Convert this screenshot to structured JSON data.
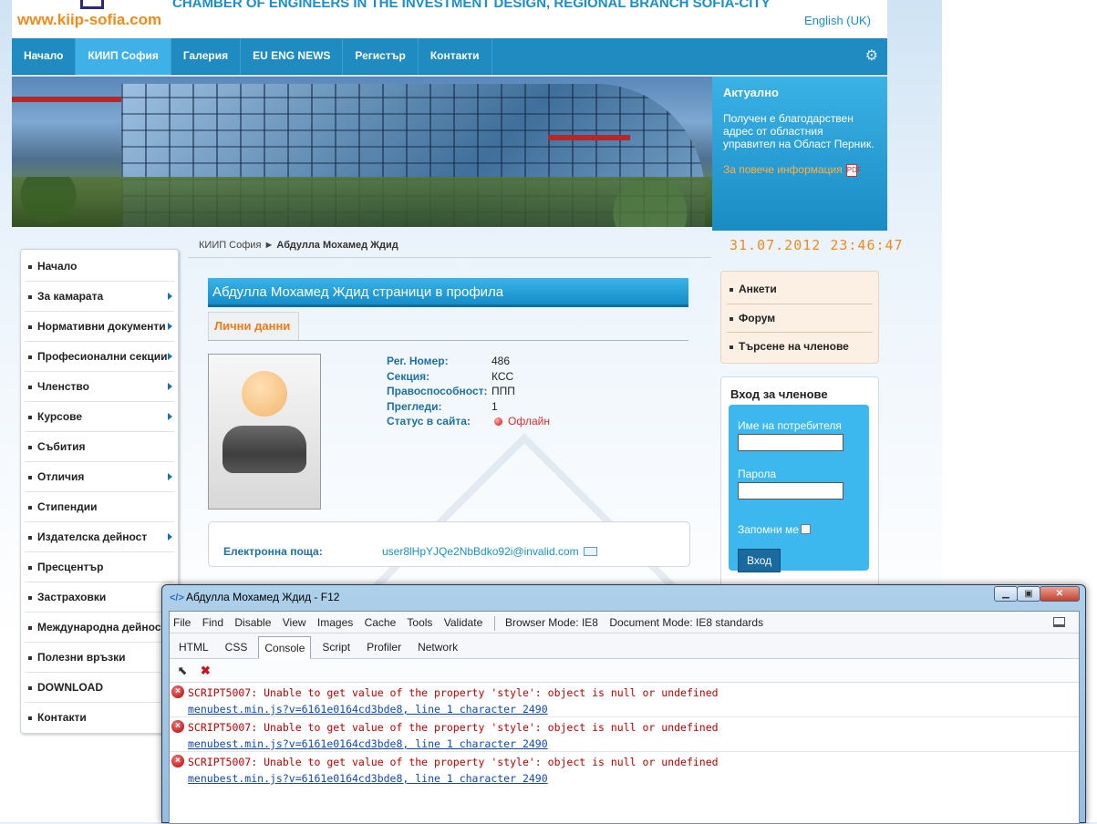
{
  "header": {
    "site_url": "www.kiip-sofia.com",
    "org_name": "CHAMBER OF ENGINEERS IN THE INVESTMENT DESIGN, REGIONAL BRANCH SOFIA-CITY",
    "language": "English (UK)"
  },
  "nav": {
    "items": [
      "Начало",
      "КИИП София",
      "Галерия",
      "EU ENG NEWS",
      "Регистър",
      "Контакти"
    ],
    "active": "КИИП София"
  },
  "actual": {
    "title": "Актуално",
    "text": "Получен е благодарствен адрес от областния управител на  Област Перник.",
    "more": "За повече информация"
  },
  "left_menu": {
    "items": [
      {
        "label": "Начало",
        "arrow": false
      },
      {
        "label": "За камарата",
        "arrow": true
      },
      {
        "label": "Нормативни документи",
        "arrow": true
      },
      {
        "label": "Професионални секции",
        "arrow": true
      },
      {
        "label": "Членство",
        "arrow": true
      },
      {
        "label": "Курсове",
        "arrow": true
      },
      {
        "label": "Събития",
        "arrow": false
      },
      {
        "label": "Отличия",
        "arrow": true
      },
      {
        "label": "Стипендии",
        "arrow": false
      },
      {
        "label": "Издателска дейност",
        "arrow": true
      },
      {
        "label": "Пресцентър",
        "arrow": false
      },
      {
        "label": "Застраховки",
        "arrow": false
      },
      {
        "label": "Международна дейност",
        "arrow": false
      },
      {
        "label": "Полезни връзки",
        "arrow": false
      },
      {
        "label": "DOWNLOAD",
        "arrow": false
      },
      {
        "label": "Контакти",
        "arrow": false
      }
    ]
  },
  "breadcrumb": {
    "root": "КИИП София",
    "current": "Абдулла Мохамед Ждид"
  },
  "clock": "31.07.2012 23:46:47",
  "profile": {
    "title": "Абдулла Мохамед Ждид страници в профила",
    "tab": "Лични данни",
    "fields": [
      {
        "label": "Рег. Номер:",
        "value": "486"
      },
      {
        "label": "Секция:",
        "value": "КСС"
      },
      {
        "label": "Правоспособност:",
        "value": "ППП"
      },
      {
        "label": "Прегледи:",
        "value": "1"
      }
    ],
    "status_label": "Статус в сайта:",
    "status_value": "Офлайн",
    "email_label": "Електронна поща:",
    "email_value": "user8lHpYJQe2NbBdko92i@invalid.com"
  },
  "right_modules": {
    "links": [
      "Анкети",
      "Форум",
      "Търсене на членове"
    ],
    "login": {
      "title": "Вход за членове",
      "username_label": "Име на потребителя",
      "password_label": "Парола",
      "remember_label": "Запомни ме",
      "button": "Вход"
    }
  },
  "devtools": {
    "title": "Абдулла Мохамед Ждид - F12",
    "menu": [
      "File",
      "Find",
      "Disable",
      "View",
      "Images",
      "Cache",
      "Tools",
      "Validate"
    ],
    "browser_mode": "Browser Mode: IE8",
    "document_mode": "Document Mode: IE8 standards",
    "tabs": [
      "HTML",
      "CSS",
      "Console",
      "Script",
      "Profiler",
      "Network"
    ],
    "active_tab": "Console",
    "errors": [
      {
        "message": "SCRIPT5007: Unable to get value of the property 'style': object is null or undefined",
        "source": "menubest.min.js?v=6161e0164cd3bde8, line 1 character 2490"
      },
      {
        "message": "SCRIPT5007: Unable to get value of the property 'style': object is null or undefined",
        "source": "menubest.min.js?v=6161e0164cd3bde8, line 1 character 2490"
      },
      {
        "message": "SCRIPT5007: Unable to get value of the property 'style': object is null or undefined",
        "source": "menubest.min.js?v=6161e0164cd3bde8, line 1 character 2490"
      }
    ]
  }
}
